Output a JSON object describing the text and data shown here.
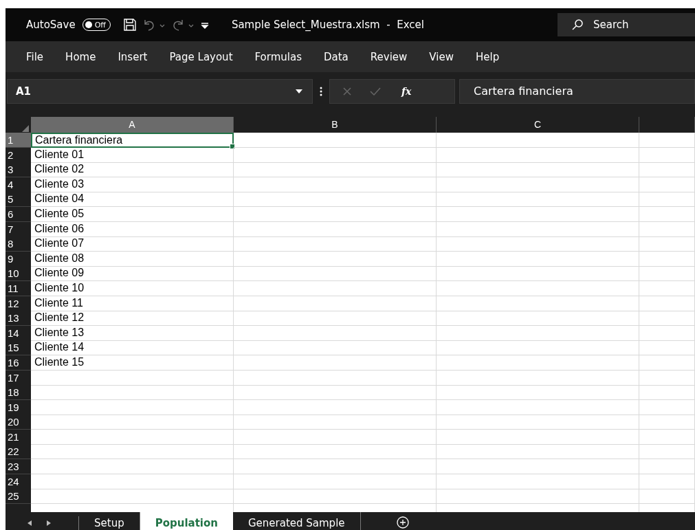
{
  "title_bar": {
    "autosave_label": "AutoSave",
    "autosave_toggle": {
      "label": "Off",
      "on": false
    },
    "title": "Sample Select_Muestra.xlsm  -  Excel",
    "search": {
      "placeholder": "Search"
    }
  },
  "menu": [
    "File",
    "Home",
    "Insert",
    "Page Layout",
    "Formulas",
    "Data",
    "Review",
    "View",
    "Help"
  ],
  "formula_bar": {
    "name_box": "A1",
    "function_button": "fx",
    "formula": "Cartera financiera"
  },
  "columns": [
    {
      "label": "A",
      "selected": true
    },
    {
      "label": "B",
      "selected": false
    },
    {
      "label": "C",
      "selected": false
    }
  ],
  "rows": [
    {
      "number": "1",
      "cells": [
        "Cartera financiera"
      ],
      "selected": true
    },
    {
      "number": "2",
      "cells": [
        "Cliente 01"
      ],
      "selected": false
    },
    {
      "number": "3",
      "cells": [
        "Cliente 02"
      ],
      "selected": false
    },
    {
      "number": "4",
      "cells": [
        "Cliente 03"
      ],
      "selected": false
    },
    {
      "number": "5",
      "cells": [
        "Cliente 04"
      ],
      "selected": false
    },
    {
      "number": "6",
      "cells": [
        "Cliente 05"
      ],
      "selected": false
    },
    {
      "number": "7",
      "cells": [
        "Cliente 06"
      ],
      "selected": false
    },
    {
      "number": "8",
      "cells": [
        "Cliente 07"
      ],
      "selected": false
    },
    {
      "number": "9",
      "cells": [
        "Cliente 08"
      ],
      "selected": false
    },
    {
      "number": "10",
      "cells": [
        "Cliente 09"
      ],
      "selected": false
    },
    {
      "number": "11",
      "cells": [
        "Cliente 10"
      ],
      "selected": false
    },
    {
      "number": "12",
      "cells": [
        "Cliente 11"
      ],
      "selected": false
    },
    {
      "number": "13",
      "cells": [
        "Cliente 12"
      ],
      "selected": false
    },
    {
      "number": "14",
      "cells": [
        "Cliente 13"
      ],
      "selected": false
    },
    {
      "number": "15",
      "cells": [
        "Cliente 14"
      ],
      "selected": false
    },
    {
      "number": "16",
      "cells": [
        "Cliente 15"
      ],
      "selected": false
    },
    {
      "number": "17",
      "cells": [],
      "selected": false
    },
    {
      "number": "18",
      "cells": [],
      "selected": false
    },
    {
      "number": "19",
      "cells": [],
      "selected": false
    },
    {
      "number": "20",
      "cells": [],
      "selected": false
    },
    {
      "number": "21",
      "cells": [],
      "selected": false
    },
    {
      "number": "22",
      "cells": [],
      "selected": false
    },
    {
      "number": "23",
      "cells": [],
      "selected": false
    },
    {
      "number": "24",
      "cells": [],
      "selected": false
    },
    {
      "number": "25",
      "cells": [],
      "selected": false
    }
  ],
  "sheet_tabs": [
    {
      "label": "Setup",
      "selected": false
    },
    {
      "label": "Population",
      "selected": true
    },
    {
      "label": "Generated Sample",
      "selected": false
    }
  ]
}
